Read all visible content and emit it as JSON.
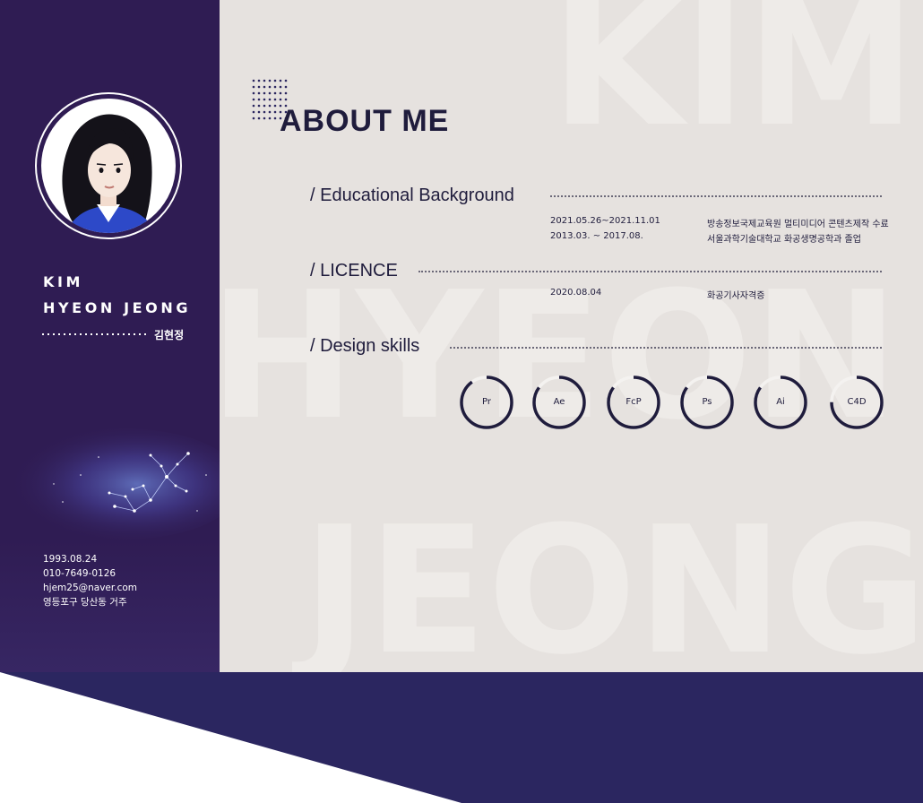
{
  "profile": {
    "name_line1": "KIM",
    "name_line2": "HYEON JEONG",
    "name_korean": "김현정",
    "birth": "1993.08.24",
    "phone": "010-7649-0126",
    "email": "hjem25@naver.com",
    "address": "영등포구 당산동 거주"
  },
  "background_words": [
    "KIM",
    "HYEON",
    "JEONG"
  ],
  "about": {
    "title": "ABOUT ME",
    "education": {
      "title": "/ Educational Background",
      "rows": [
        {
          "date": "2021.05.26~2021.11.01",
          "desc": "방송정보국제교육원 멀티미디어 콘텐츠제작 수료"
        },
        {
          "date": "2013.03. ~ 2017.08.",
          "desc": "서울과학기술대학교 화공생명공학과 졸업"
        }
      ]
    },
    "licence": {
      "title": "/ LICENCE",
      "rows": [
        {
          "date": "2020.08.04",
          "desc": "화공기사자격증"
        }
      ]
    },
    "skills": {
      "title": "/ Design skills",
      "items": [
        {
          "label": "Pr",
          "level": 0.9
        },
        {
          "label": "Ae",
          "level": 0.85
        },
        {
          "label": "FcP",
          "level": 0.85
        },
        {
          "label": "Ps",
          "level": 0.85
        },
        {
          "label": "Ai",
          "level": 0.85
        },
        {
          "label": "C4D",
          "level": 0.75
        }
      ]
    }
  },
  "colors": {
    "sidebar": "#2f1c53",
    "main_bg": "#e6e2df",
    "text_dark": "#1f1c3c",
    "bottom_band": "#2b2660"
  }
}
